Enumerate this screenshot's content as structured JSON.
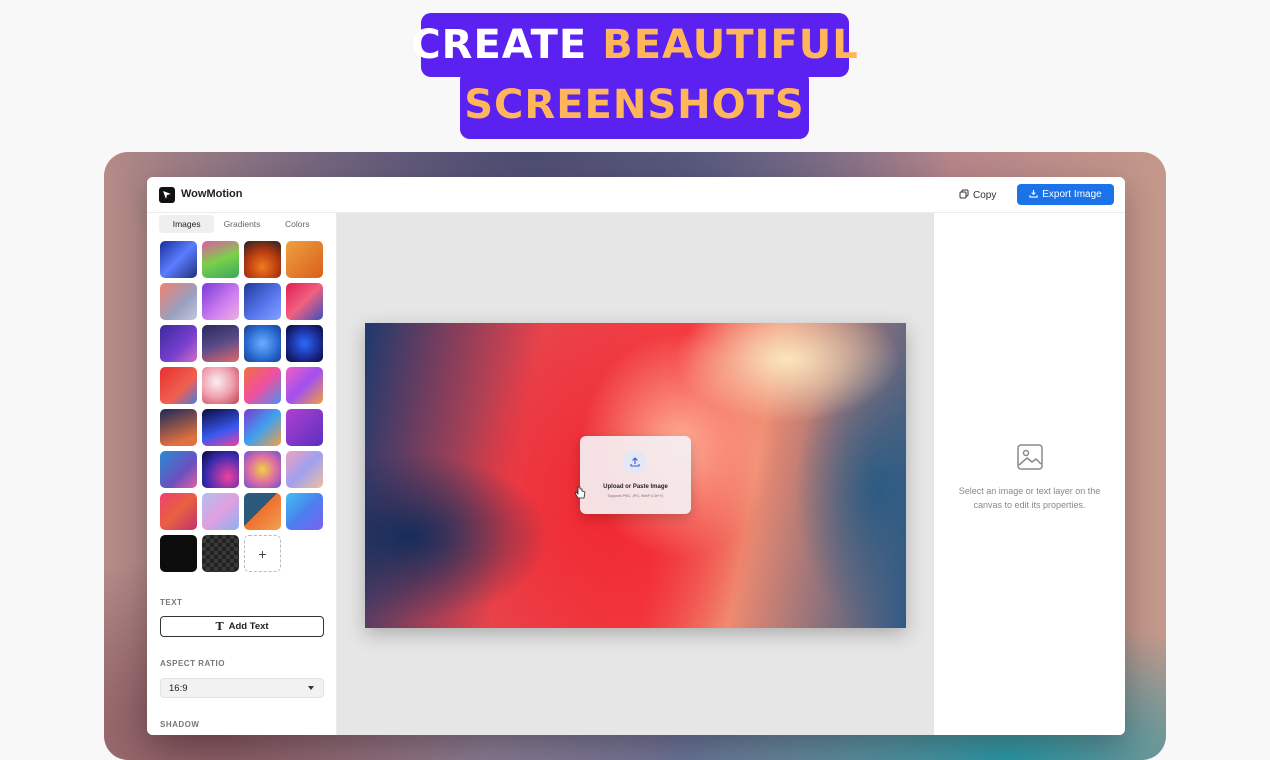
{
  "hero": {
    "line1_white": "CREATE",
    "line1_gold": "BEAUTIFUL",
    "line2_gold": "SCREENSHOTS",
    "badge_color": "#5b21f0",
    "accent_color": "#ffb55a"
  },
  "app": {
    "title": "WowMotion",
    "logo_icon": "cursor-logo-icon",
    "copy_label": "Copy",
    "export_label": "Export Image",
    "accent": "#1a73e8"
  },
  "sidebar": {
    "tabs": [
      {
        "label": "Images",
        "active": true
      },
      {
        "label": "Gradients",
        "active": false
      },
      {
        "label": "Colors",
        "active": false
      }
    ],
    "add_background_label": "+",
    "text_section_label": "TEXT",
    "add_text_label": "Add Text",
    "aspect_ratio_label": "ASPECT RATIO",
    "aspect_ratio_value": "16:9",
    "shadow_label": "SHADOW"
  },
  "canvas": {
    "upload_title": "Upload or Paste Image",
    "upload_subtitle": "Supports PNG, JPG, WebP (Ctrl+V)"
  },
  "properties_panel": {
    "empty_message": "Select an image or text layer on the canvas to edit its properties."
  }
}
